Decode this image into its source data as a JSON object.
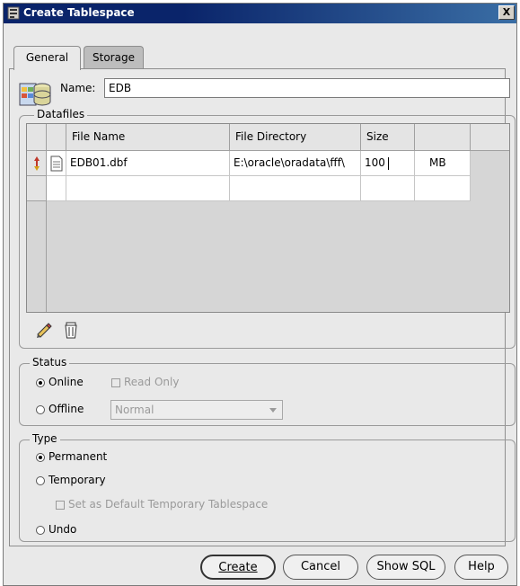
{
  "window": {
    "title": "Create Tablespace",
    "close_glyph": "X"
  },
  "tabs": [
    {
      "label": "General",
      "active": true
    },
    {
      "label": "Storage",
      "active": false
    }
  ],
  "name": {
    "label": "Name:",
    "value": "EDB"
  },
  "datafiles": {
    "label": "Datafiles",
    "columns": [
      "File Name",
      "File Directory",
      "Size"
    ],
    "rows": [
      {
        "file_name": "EDB01.dbf",
        "directory": "E:\\oracle\\oradata\\fff\\",
        "size": "100",
        "unit": "MB"
      }
    ],
    "tools": [
      "pencil-icon",
      "trash-icon"
    ]
  },
  "status": {
    "label": "Status",
    "online": "Online",
    "read_only": "Read Only",
    "offline": "Offline",
    "offline_mode": "Normal",
    "selected": "Online"
  },
  "type": {
    "label": "Type",
    "permanent": "Permanent",
    "temporary": "Temporary",
    "default_temp": "Set as Default Temporary Tablespace",
    "undo": "Undo",
    "selected": "Permanent"
  },
  "buttons": {
    "create": "Create",
    "cancel": "Cancel",
    "show_sql": "Show SQL",
    "help": "Help"
  }
}
